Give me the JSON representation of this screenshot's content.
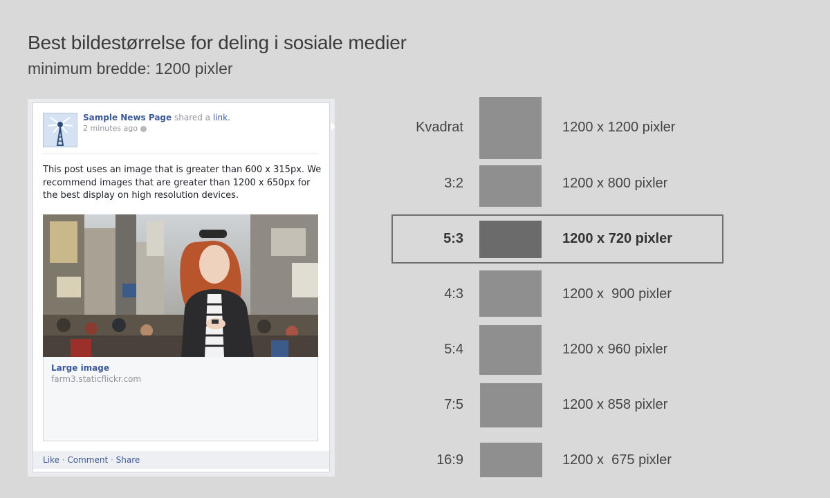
{
  "header": {
    "title": "Best bildestørrelse for deling i sosiale medier",
    "subtitle": "minimum bredde: 1200 pixler"
  },
  "post": {
    "page_name": "Sample News Page",
    "shared_text": "shared a",
    "link_word": "link.",
    "time": "2 minutes ago",
    "body": "This post uses an image that is greater than 600 x 315px. We recommend images that are greater than 1200 x 650px for the best display on high resolution devices.",
    "link_title": "Large image",
    "link_url": "farm3.staticflickr.com",
    "actions": {
      "like": "Like",
      "comment": "Comment",
      "share": "Share",
      "separator": " · "
    }
  },
  "ratios": [
    {
      "label": "Kvadrat",
      "size": "1200 x 1200 pixler",
      "highlighted": false
    },
    {
      "label": "3:2",
      "size": "1200 x 800 pixler",
      "highlighted": false
    },
    {
      "label": "5:3",
      "size": "1200 x 720 pixler",
      "highlighted": true
    },
    {
      "label": "4:3",
      "size": "1200 x  900 pixler",
      "highlighted": false
    },
    {
      "label": "5:4",
      "size": "1200 x 960 pixler",
      "highlighted": false
    },
    {
      "label": "7:5",
      "size": "1200 x 858 pixler",
      "highlighted": false
    },
    {
      "label": "16:9",
      "size": "1200 x  675 pixler",
      "highlighted": false
    }
  ],
  "colors": {
    "background": "#d9d9d9",
    "swatch": "#8f8f8f",
    "swatch_highlight": "#6b6b6b",
    "facebook_blue": "#3b5998"
  }
}
